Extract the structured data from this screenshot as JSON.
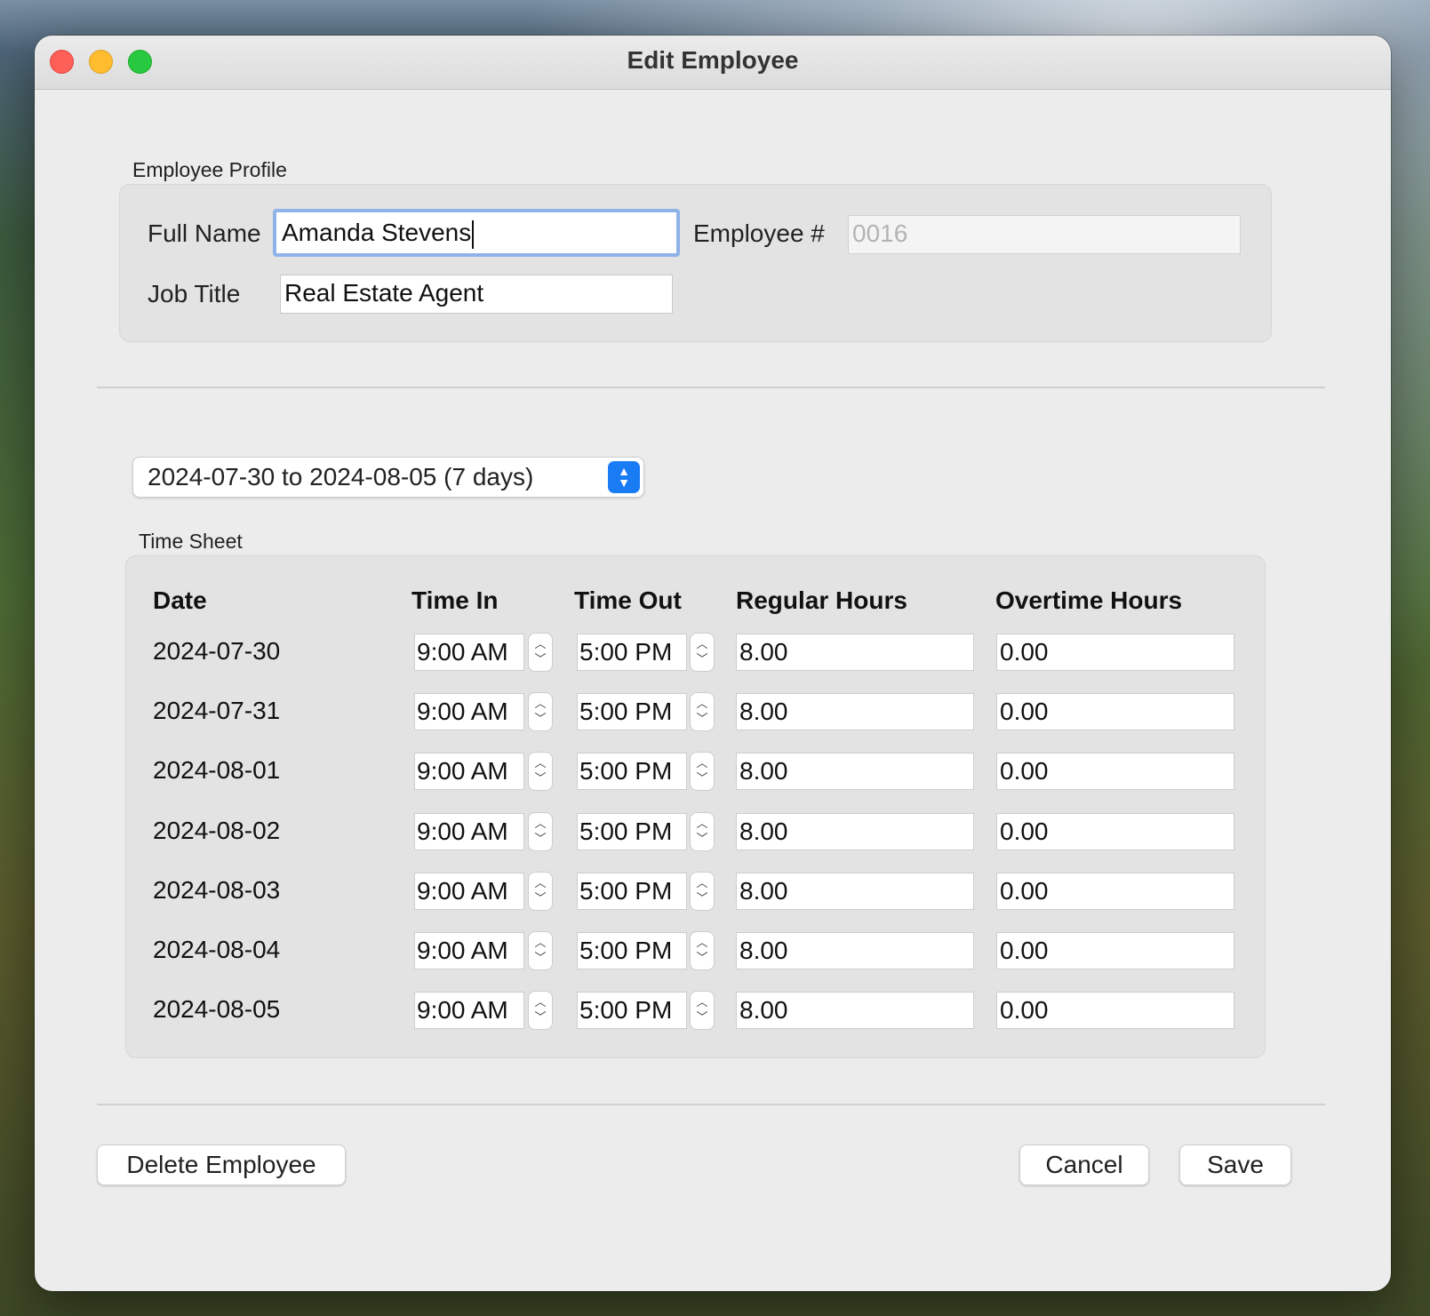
{
  "window": {
    "title": "Edit Employee"
  },
  "profile": {
    "group_label": "Employee Profile",
    "full_name_label": "Full Name",
    "full_name_value": "Amanda Stevens",
    "employee_num_label": "Employee #",
    "employee_num_value": "0016",
    "job_title_label": "Job Title",
    "job_title_value": "Real Estate Agent"
  },
  "period": {
    "selected": "2024-07-30 to 2024-08-05 (7 days)"
  },
  "timesheet": {
    "group_label": "Time Sheet",
    "columns": {
      "date": "Date",
      "time_in": "Time In",
      "time_out": "Time Out",
      "regular": "Regular Hours",
      "overtime": "Overtime Hours"
    },
    "rows": [
      {
        "date": "2024-07-30",
        "time_in": "9:00 AM",
        "time_out": "5:00 PM",
        "regular": "8.00",
        "overtime": "0.00"
      },
      {
        "date": "2024-07-31",
        "time_in": "9:00 AM",
        "time_out": "5:00 PM",
        "regular": "8.00",
        "overtime": "0.00"
      },
      {
        "date": "2024-08-01",
        "time_in": "9:00 AM",
        "time_out": "5:00 PM",
        "regular": "8.00",
        "overtime": "0.00"
      },
      {
        "date": "2024-08-02",
        "time_in": "9:00 AM",
        "time_out": "5:00 PM",
        "regular": "8.00",
        "overtime": "0.00"
      },
      {
        "date": "2024-08-03",
        "time_in": "9:00 AM",
        "time_out": "5:00 PM",
        "regular": "8.00",
        "overtime": "0.00"
      },
      {
        "date": "2024-08-04",
        "time_in": "9:00 AM",
        "time_out": "5:00 PM",
        "regular": "8.00",
        "overtime": "0.00"
      },
      {
        "date": "2024-08-05",
        "time_in": "9:00 AM",
        "time_out": "5:00 PM",
        "regular": "8.00",
        "overtime": "0.00"
      }
    ]
  },
  "buttons": {
    "delete": "Delete Employee",
    "cancel": "Cancel",
    "save": "Save"
  },
  "colors": {
    "accent": "#1a7cf5",
    "focus_ring": "#8fb2e8",
    "close": "#fe5f57",
    "minimize": "#febc2e",
    "maximize": "#28c840"
  }
}
